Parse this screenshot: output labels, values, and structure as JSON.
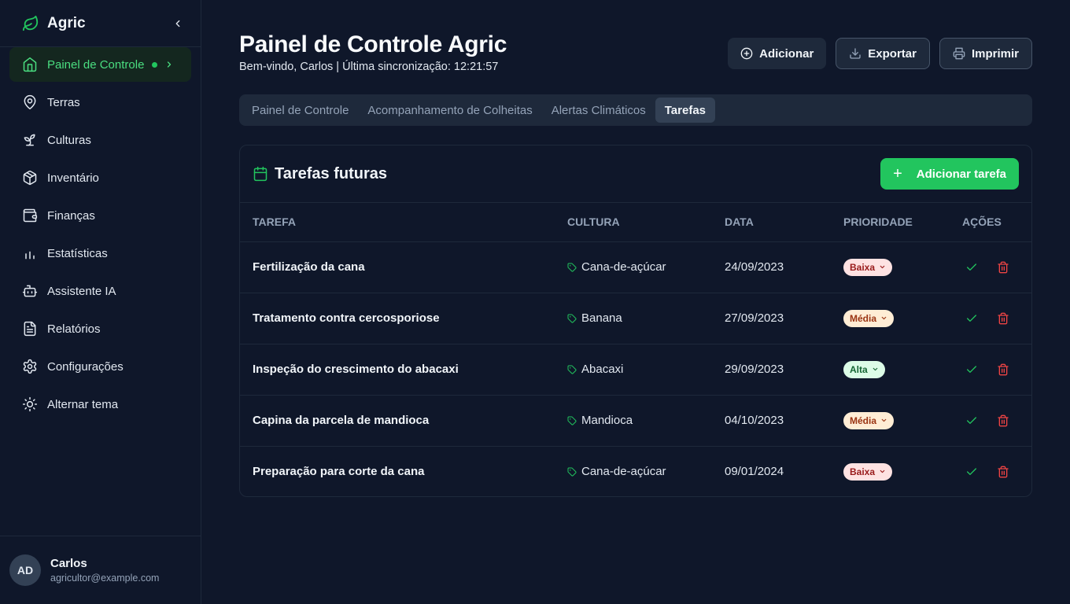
{
  "app": {
    "name": "Agric"
  },
  "sidebar": {
    "items": [
      {
        "label": "Painel de Controle",
        "icon": "home-icon",
        "active": true
      },
      {
        "label": "Terras",
        "icon": "map-pin-icon"
      },
      {
        "label": "Culturas",
        "icon": "sprout-icon"
      },
      {
        "label": "Inventário",
        "icon": "package-icon"
      },
      {
        "label": "Finanças",
        "icon": "wallet-icon"
      },
      {
        "label": "Estatísticas",
        "icon": "bar-chart-icon"
      },
      {
        "label": "Assistente IA",
        "icon": "bot-icon"
      },
      {
        "label": "Relatórios",
        "icon": "file-text-icon"
      },
      {
        "label": "Configurações",
        "icon": "settings-icon"
      },
      {
        "label": "Alternar tema",
        "icon": "sun-icon"
      }
    ]
  },
  "user": {
    "initials": "AD",
    "name": "Carlos",
    "email": "agricultor@example.com"
  },
  "header": {
    "title": "Painel de Controle Agric",
    "subtitle": "Bem-vindo, Carlos | Última sincronização: 12:21:57"
  },
  "actions": {
    "add": "Adicionar",
    "export": "Exportar",
    "print": "Imprimir"
  },
  "tabs": [
    {
      "label": "Painel de Controle",
      "active": false
    },
    {
      "label": "Acompanhamento de Colheitas",
      "active": false
    },
    {
      "label": "Alertas Climáticos",
      "active": false
    },
    {
      "label": "Tarefas",
      "active": true
    }
  ],
  "tasks_card": {
    "title": "Tarefas futuras",
    "add_button": "Adicionar tarefa",
    "columns": [
      "Tarefa",
      "Cultura",
      "Data",
      "Prioridade",
      "Ações"
    ],
    "rows": [
      {
        "task": "Fertilização da cana",
        "crop": "Cana-de-açúcar",
        "date": "24/09/2023",
        "priority": "Baixa",
        "level": "low"
      },
      {
        "task": "Tratamento contra cercosporiose",
        "crop": "Banana",
        "date": "27/09/2023",
        "priority": "Média",
        "level": "mid"
      },
      {
        "task": "Inspeção do crescimento do abacaxi",
        "crop": "Abacaxi",
        "date": "29/09/2023",
        "priority": "Alta",
        "level": "high"
      },
      {
        "task": "Capina da parcela de mandioca",
        "crop": "Mandioca",
        "date": "04/10/2023",
        "priority": "Média",
        "level": "mid"
      },
      {
        "task": "Preparação para corte da cana",
        "crop": "Cana-de-açúcar",
        "date": "09/01/2024",
        "priority": "Baixa",
        "level": "low"
      }
    ]
  },
  "colors": {
    "accent": "#22c55e",
    "background": "#0f172a",
    "panel": "#1e293b"
  }
}
